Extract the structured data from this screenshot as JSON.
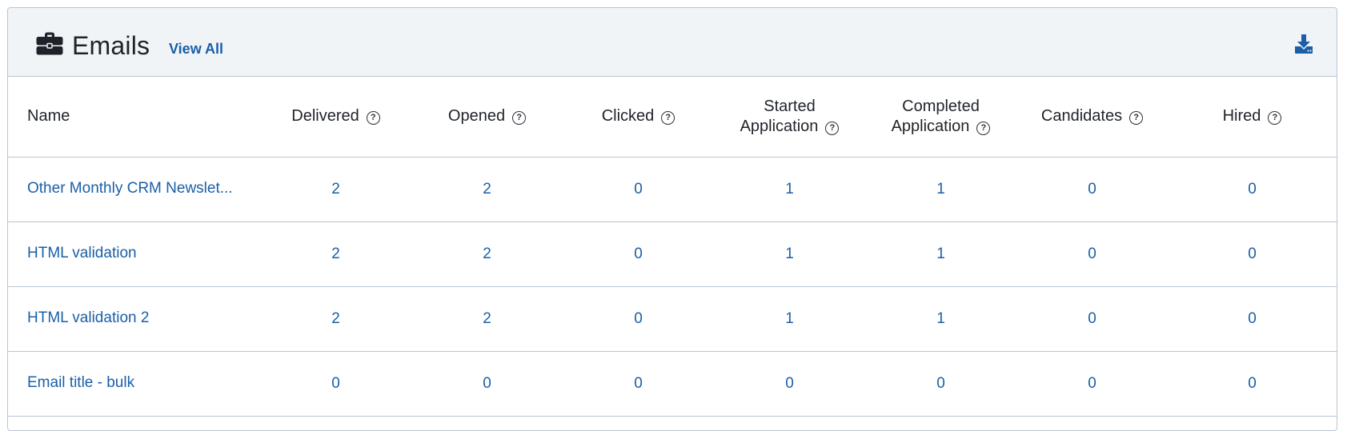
{
  "header": {
    "title": "Emails",
    "view_all_label": "View All",
    "icon": "briefcase-icon",
    "download_icon": "download-icon"
  },
  "table": {
    "columns": [
      {
        "label": "Name"
      },
      {
        "line1": "Delivered",
        "help": "?"
      },
      {
        "line1": "Opened",
        "help": "?"
      },
      {
        "line1": "Clicked",
        "help": "?"
      },
      {
        "line1": "Started",
        "line2": "Application",
        "help": "?"
      },
      {
        "line1": "Completed",
        "line2": "Application",
        "help": "?"
      },
      {
        "line1": "Candidates",
        "help": "?"
      },
      {
        "line1": "Hired",
        "help": "?"
      }
    ],
    "rows": [
      {
        "name": "Other Monthly CRM Newslet...",
        "values": [
          "2",
          "2",
          "0",
          "1",
          "1",
          "0",
          "0"
        ]
      },
      {
        "name": "HTML validation",
        "values": [
          "2",
          "2",
          "0",
          "1",
          "1",
          "0",
          "0"
        ]
      },
      {
        "name": "HTML validation 2",
        "values": [
          "2",
          "2",
          "0",
          "1",
          "1",
          "0",
          "0"
        ]
      },
      {
        "name": "Email title - bulk",
        "values": [
          "0",
          "0",
          "0",
          "0",
          "0",
          "0",
          "0"
        ]
      }
    ]
  },
  "colors": {
    "link": "#1a5fa8",
    "header_bg": "#f0f4f7",
    "border": "#b9c6d3",
    "text": "#1f2329"
  }
}
